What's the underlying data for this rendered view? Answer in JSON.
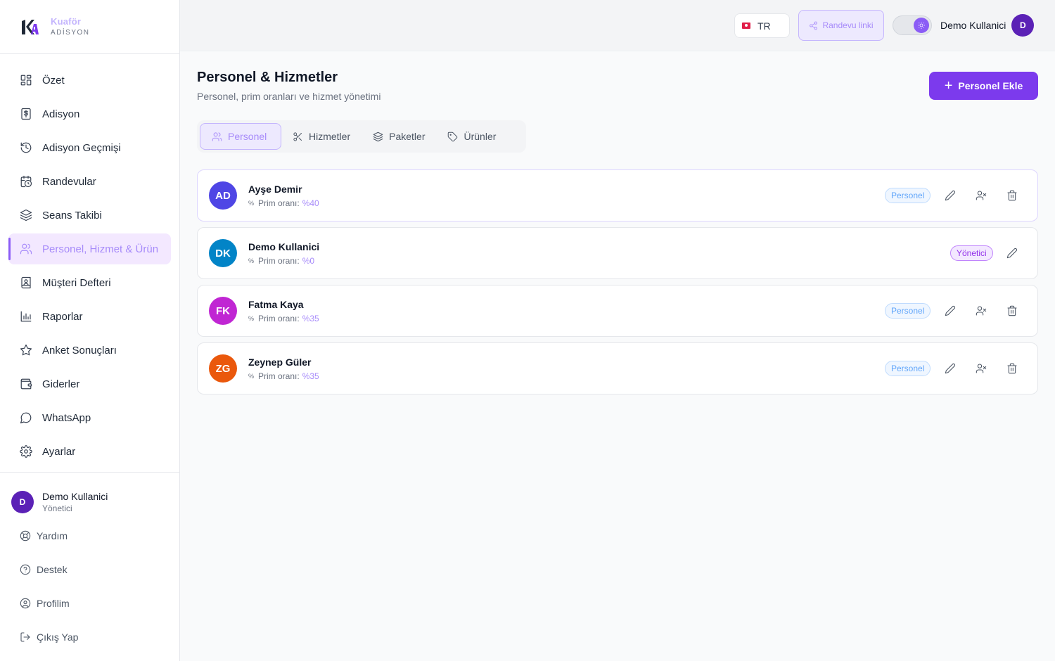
{
  "brand": {
    "name": "Kuaför",
    "sub": "ADİSYON"
  },
  "nav": [
    {
      "label": "Özet",
      "icon": "dashboard-icon",
      "active": false
    },
    {
      "label": "Adisyon",
      "icon": "receipt-icon",
      "active": false
    },
    {
      "label": "Adisyon Geçmişi",
      "icon": "history-icon",
      "active": false
    },
    {
      "label": "Randevular",
      "icon": "calendar-clock-icon",
      "active": false
    },
    {
      "label": "Seans Takibi",
      "icon": "layers-icon",
      "active": false
    },
    {
      "label": "Personel, Hizmet & Ürün",
      "icon": "users-icon",
      "active": true
    },
    {
      "label": "Müşteri Defteri",
      "icon": "contact-book-icon",
      "active": false
    },
    {
      "label": "Raporlar",
      "icon": "bar-chart-icon",
      "active": false
    },
    {
      "label": "Anket Sonuçları",
      "icon": "star-icon",
      "active": false
    },
    {
      "label": "Giderler",
      "icon": "wallet-icon",
      "active": false
    },
    {
      "label": "WhatsApp",
      "icon": "chat-bubble-icon",
      "active": false
    },
    {
      "label": "Ayarlar",
      "icon": "gear-icon",
      "active": false
    }
  ],
  "sidebar_user": {
    "initial": "D",
    "name": "Demo Kullanici",
    "role": "Yönetici"
  },
  "sidebar_links": [
    {
      "label": "Yardım",
      "icon": "lifebuoy-icon"
    },
    {
      "label": "Destek",
      "icon": "help-circle-icon"
    },
    {
      "label": "Profilim",
      "icon": "user-circle-icon"
    },
    {
      "label": "Çıkış Yap",
      "icon": "logout-icon"
    }
  ],
  "topbar": {
    "lang": "TR",
    "randevu_link": "Randevu linki",
    "theme_toggle_on": true,
    "user_name": "Demo Kullanici",
    "user_initial": "D"
  },
  "page": {
    "title": "Personel & Hizmetler",
    "subtitle": "Personel, prim oranları ve hizmet yönetimi",
    "add_button": "Personel Ekle"
  },
  "tabs": [
    {
      "label": "Personel",
      "icon": "users-icon",
      "active": true
    },
    {
      "label": "Hizmetler",
      "icon": "scissors-icon",
      "active": false
    },
    {
      "label": "Paketler",
      "icon": "layers-icon",
      "active": false
    },
    {
      "label": "Ürünler",
      "icon": "tag-icon",
      "active": false
    }
  ],
  "staff_rate_label": "Prim oranı:",
  "staff": [
    {
      "initials": "AD",
      "name": "Ayşe Demir",
      "rate": "%40",
      "role": "Personel",
      "color": "#4f46e5",
      "deletable": true
    },
    {
      "initials": "DK",
      "name": "Demo Kullanici",
      "rate": "%0",
      "role": "Yönetici",
      "color": "#0284c7",
      "deletable": false
    },
    {
      "initials": "FK",
      "name": "Fatma Kaya",
      "rate": "%35",
      "role": "Personel",
      "color": "#c026d3",
      "deletable": true
    },
    {
      "initials": "ZG",
      "name": "Zeynep Güler",
      "rate": "%35",
      "role": "Personel",
      "color": "#ea580c",
      "deletable": true
    }
  ]
}
